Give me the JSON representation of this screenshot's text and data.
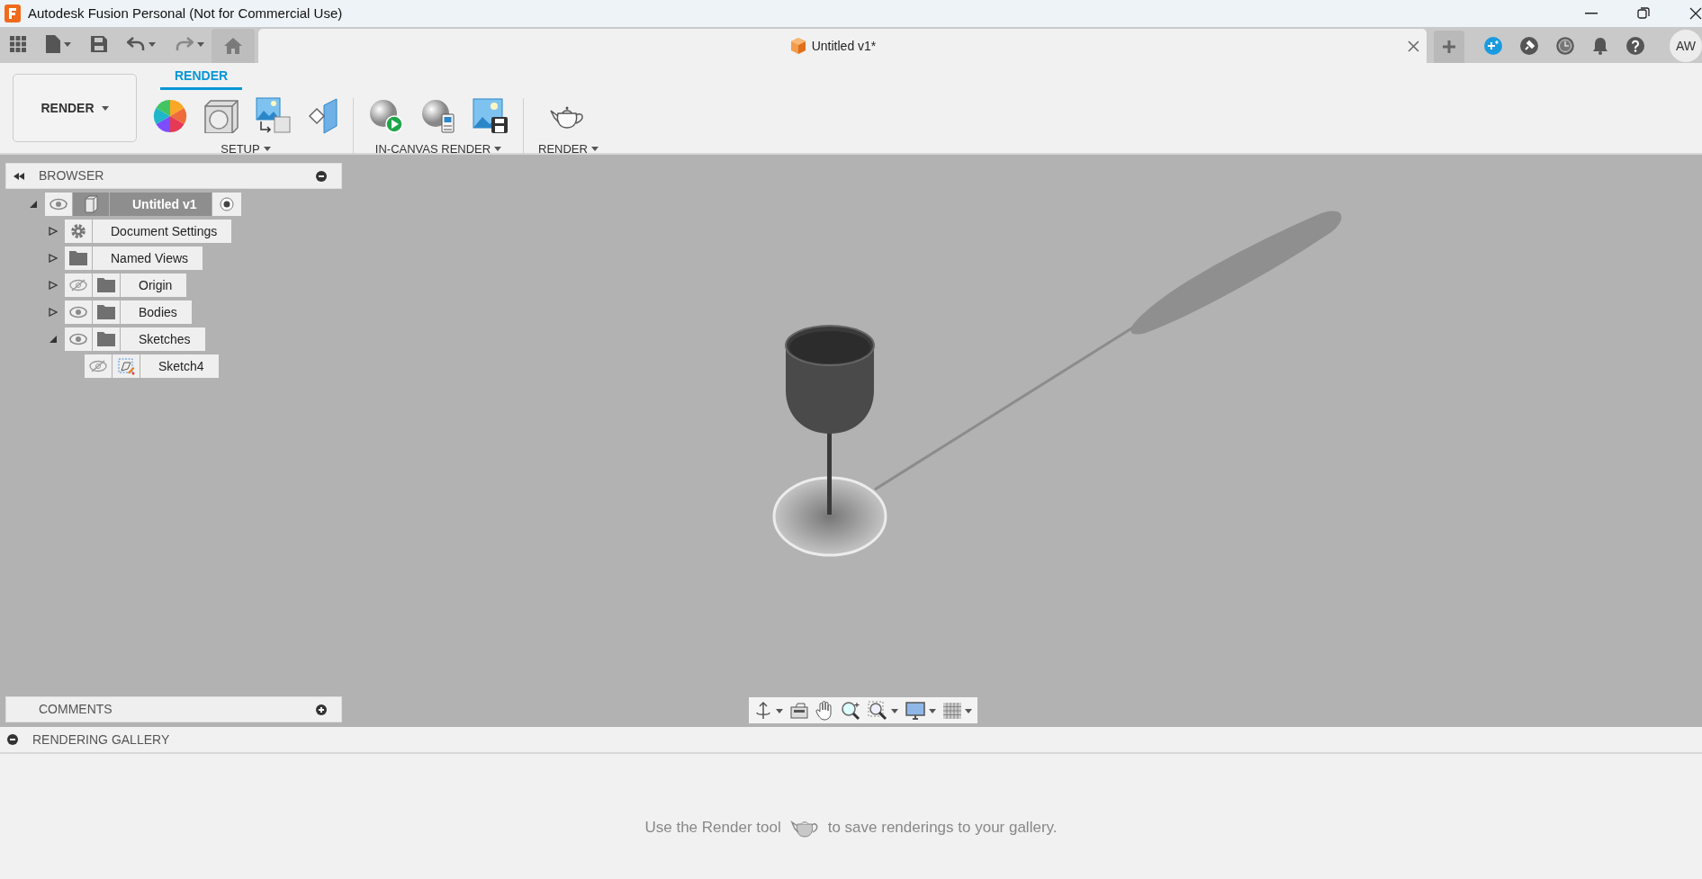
{
  "window": {
    "title": "Autodesk Fusion Personal (Not for Commercial Use)"
  },
  "document_tab": {
    "title": "Untitled v1*"
  },
  "user": {
    "initials": "AW"
  },
  "workspace": {
    "label": "RENDER"
  },
  "ribbon_tabs": [
    {
      "label": "RENDER",
      "selected": true
    }
  ],
  "ribbon_groups": [
    {
      "label": "SETUP"
    },
    {
      "label": "IN-CANVAS RENDER"
    },
    {
      "label": "RENDER"
    }
  ],
  "browser": {
    "title": "BROWSER",
    "tree": [
      {
        "label": "Untitled v1",
        "kind": "component",
        "selected": true,
        "expanded": true,
        "visible": true,
        "children": [
          {
            "label": "Document Settings",
            "kind": "settings",
            "selected": false,
            "expanded": false
          },
          {
            "label": "Named Views",
            "kind": "folder",
            "selected": false,
            "expanded": false
          },
          {
            "label": "Origin",
            "kind": "folder",
            "selected": false,
            "expanded": false,
            "visible": false
          },
          {
            "label": "Bodies",
            "kind": "folder",
            "selected": false,
            "expanded": false,
            "visible": true
          },
          {
            "label": "Sketches",
            "kind": "folder",
            "selected": false,
            "expanded": true,
            "visible": true,
            "children": [
              {
                "label": "Sketch4",
                "kind": "sketch",
                "selected": false,
                "visible": false
              }
            ]
          }
        ]
      }
    ]
  },
  "comments": {
    "title": "COMMENTS"
  },
  "gallery": {
    "title": "RENDERING GALLERY",
    "message_before": "Use the Render tool",
    "message_after": "to save renderings to your gallery."
  }
}
